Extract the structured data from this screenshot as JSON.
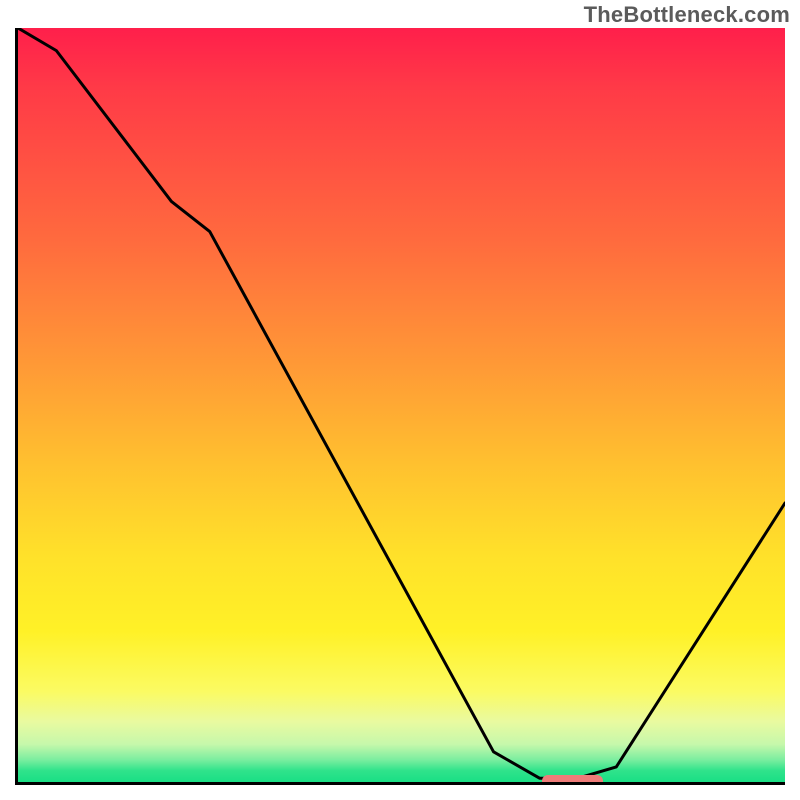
{
  "watermark": "TheBottleneck.com",
  "chart_data": {
    "type": "line",
    "title": "",
    "xlabel": "",
    "ylabel": "",
    "xlim": [
      0,
      100
    ],
    "ylim": [
      0,
      100
    ],
    "x": [
      0,
      5,
      20,
      25,
      62,
      68,
      73,
      78,
      100
    ],
    "values": [
      100,
      97,
      77,
      73,
      4,
      0.5,
      0.5,
      2,
      37
    ],
    "marker": {
      "x_start": 68,
      "x_end": 76,
      "y": 0.5
    },
    "colors": {
      "gradient_top": "#ff1f4b",
      "gradient_bottom": "#1adf85",
      "curve": "#000000",
      "marker": "#ef7c79"
    }
  }
}
